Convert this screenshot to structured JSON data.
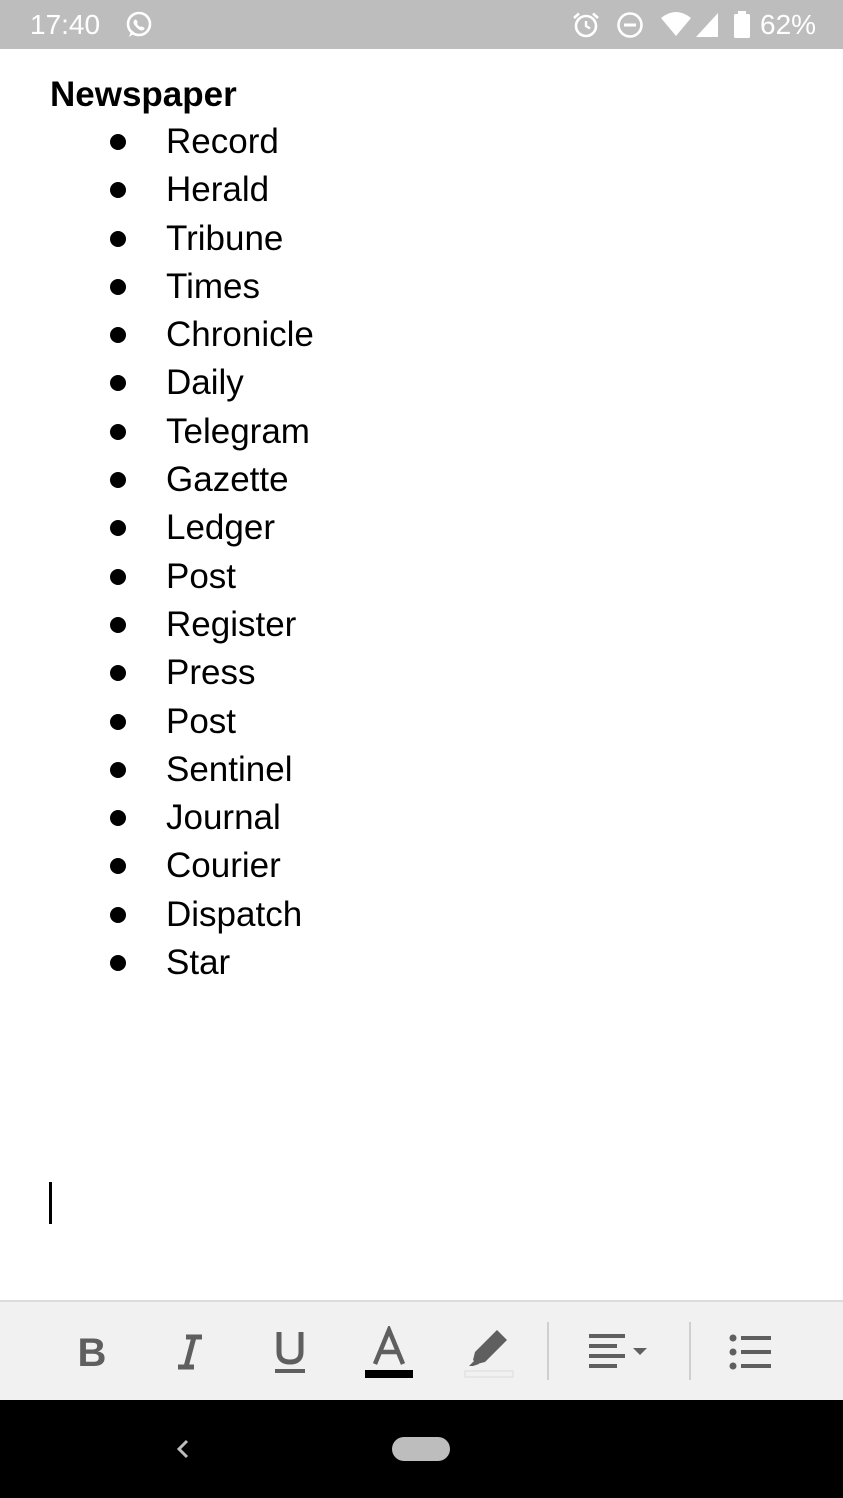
{
  "status_bar": {
    "time": "17:40",
    "battery_percent": "62%",
    "icons": [
      "whatsapp-icon",
      "alarm-icon",
      "do-not-disturb-icon",
      "wifi-icon",
      "cellular-signal-icon",
      "battery-icon"
    ]
  },
  "document": {
    "title": "Newspaper",
    "items": [
      "Record",
      "Herald",
      "Tribune",
      "Times",
      "Chronicle",
      "Daily",
      "Telegram",
      "Gazette",
      "Ledger",
      "Post",
      "Register",
      "Press",
      "Post",
      "Sentinel",
      "Journal",
      "Courier",
      "Dispatch",
      "Star"
    ]
  },
  "toolbar": {
    "buttons": [
      "bold-icon",
      "italic-icon",
      "underline-icon",
      "text-color-icon",
      "highlight-icon",
      "align-icon",
      "bulleted-list-icon"
    ],
    "text_color": "#000000",
    "highlight_color": "#f1f1f1"
  },
  "colors": {
    "status_bar_bg": "#bdbdbd",
    "toolbar_bg": "#f1f1f1",
    "icon_gray": "#5f5f5f",
    "nav_bar_bg": "#000000"
  }
}
